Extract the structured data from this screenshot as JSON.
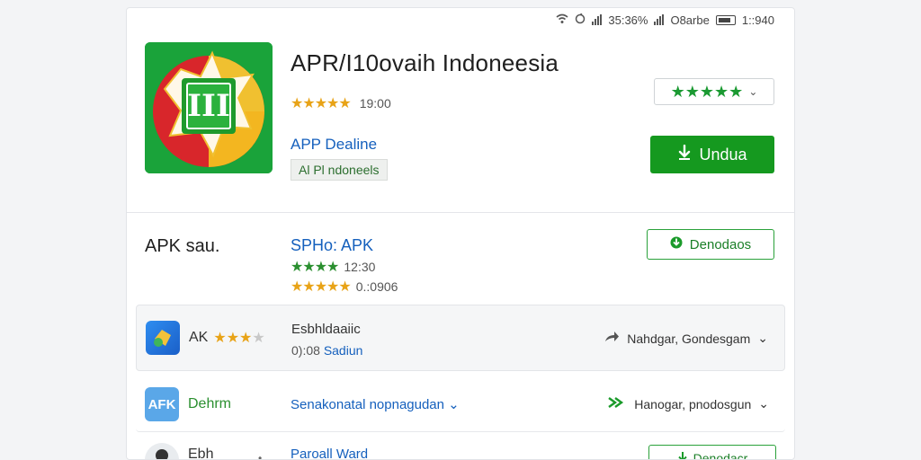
{
  "statusbar": {
    "signal_text": "35:36%",
    "carrier": "O8arbe",
    "time": "1::940"
  },
  "hero": {
    "title": "APR/I10ovaih Indoneesia",
    "rating_stars": "★★★★★",
    "rating_value": "19:00",
    "developer": "APP Dealine",
    "tag": "Al Pl ndoneels",
    "rate_select_stars": "★★★★★",
    "install_button": "Undua"
  },
  "section": {
    "label": "APK sau.",
    "app_name": "SPHo: APK",
    "rating1_stars": "★★★★",
    "rating1_value": "12:30",
    "rating2_stars": "★★★★★",
    "rating2_value": "0.:0906",
    "download_button": "Denodaos"
  },
  "rows": [
    {
      "left_label": "AK",
      "left_stars": "★★★",
      "left_star_empty": "★",
      "mid1": "Esbhldaaiic",
      "mid2_prefix": "0):08",
      "mid2_link": "Sadiun",
      "right": "Nahdgar, Gondesgam"
    },
    {
      "left_label": "Dehrm",
      "icon_text": "AFK",
      "mid1": "Senakonatal nopnagudan",
      "right": "Hanogar, pnodosgun"
    },
    {
      "left_label": "Ebh",
      "mid1": "Paroall Ward",
      "button": "Denodacr"
    }
  ],
  "colors": {
    "accent_green": "#15991f",
    "link_blue": "#1560bd",
    "star_gold": "#e8a317"
  }
}
